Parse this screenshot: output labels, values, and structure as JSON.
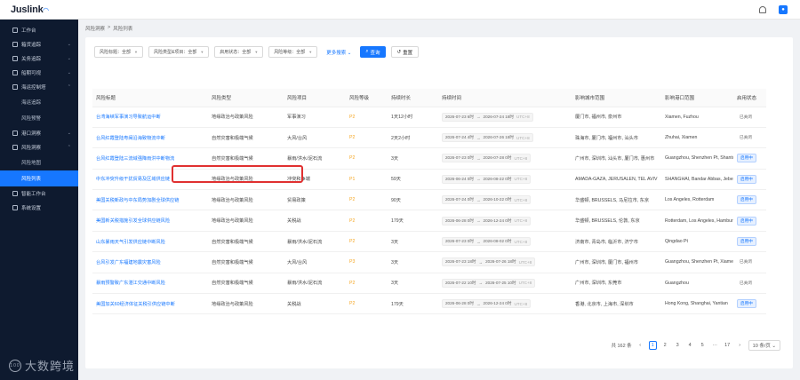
{
  "app": {
    "logo": "Juslink"
  },
  "sidebar": {
    "items": [
      {
        "label": "工作台",
        "icon": "home-icon"
      },
      {
        "label": "箱货追踪",
        "icon": "box-icon"
      },
      {
        "label": "关务追踪",
        "icon": "customs-icon"
      },
      {
        "label": "船期可视",
        "icon": "ship-icon"
      },
      {
        "label": "海运控制塔",
        "icon": "tower-icon"
      }
    ],
    "tower_sub": [
      {
        "label": "海运追踪"
      },
      {
        "label": "风险预警"
      }
    ],
    "items2": [
      {
        "label": "港口洞察",
        "icon": "port-icon"
      },
      {
        "label": "风险洞察",
        "icon": "risk-icon"
      }
    ],
    "risk_sub": [
      {
        "label": "风险地图"
      },
      {
        "label": "风险列表"
      }
    ],
    "items3": [
      {
        "label": "智能工作台",
        "icon": "smart-icon"
      },
      {
        "label": "系统设置",
        "icon": "settings-icon"
      }
    ],
    "watermark": "大数跨境"
  },
  "breadcrumb": {
    "parent": "风险洞察",
    "sep": ">",
    "current": "风险列表"
  },
  "filters": {
    "title": "风险标题：全部",
    "type": "风险类型&项目：全部",
    "status": "启用状态：全部",
    "level": "风险等级：全部",
    "more": "更多搜索",
    "query": "查询",
    "reset": "重置"
  },
  "table": {
    "headers": [
      "风险标题",
      "风险类型",
      "风险项目",
      "风险等级",
      "持续时长",
      "持续时间",
      "影响城市范围",
      "影响港口范围",
      "启用状态"
    ],
    "rows": [
      {
        "title": "台湾海峡军事演习导致航运中断",
        "type": "地缘政治与政策风险",
        "item": "军事演习",
        "level": "P2",
        "dur": "1天12小时",
        "start": "2026-07-23 6时",
        "end": "2026-07-24 18时",
        "utc": "UTC+8",
        "cities": "厦门市, 福州市, 泉州市",
        "ports": "Xiamen, Fuzhou",
        "status": "已关闭",
        "on": false
      },
      {
        "title": "台风红霞登陆粤闽沿海致物流中断",
        "type": "自然灾害和极端气候",
        "item": "大风/台风",
        "level": "P2",
        "dur": "2天2小时",
        "start": "2026-07-24 4时",
        "end": "2026-07-26 18时",
        "utc": "UTC+8",
        "cities": "珠海市, 厦门市, 福州市, 汕头市",
        "ports": "Zhuhai, Xiamen",
        "status": "已关闭",
        "on": false
      },
      {
        "title": "台风红霞登陆三流域强降雨洪中断物流",
        "type": "自然灾害和极端气候",
        "item": "暴雨/洪水/泥石流",
        "level": "P2",
        "dur": "3天",
        "start": "2026-07-23 0时",
        "end": "2026-07-28 0时",
        "utc": "UTC+8",
        "cities": "广州市, 深圳市, 汕头市, 厦门市, 惠州市",
        "ports": "Guangzhou, Shenzhen Pt, Shantou",
        "status": "启用中",
        "on": true
      },
      {
        "title": "中东冲突升级干扰贸易及区域供应链",
        "type": "地缘政治与政策风险",
        "item": "冲突和争端",
        "level": "P1",
        "dur": "59天",
        "start": "2026-06-24 0时",
        "end": "2026-08-22 0时",
        "utc": "UTC+8",
        "cities": "AMADA-GAZA, JERUSALEN, TEL AVIV",
        "ports": "SHANGHAI, Bandar Abbas, Jebel Ali",
        "status": "启用中",
        "on": true
      },
      {
        "title": "美国关税新政与中东局势加剧全球供应链",
        "type": "地缘政治与政策风险",
        "item": "贸易政策",
        "level": "P2",
        "dur": "90天",
        "start": "2026-07-24 0时",
        "end": "2026-10-22 0时",
        "utc": "UTC+8",
        "cities": "华盛顿, BRUSSELS, 马尼拉市, 东京",
        "ports": "Los Angeles, Rotterdam",
        "status": "启用中",
        "on": true
      },
      {
        "title": "美国新关税措施引发全球供应链风险",
        "type": "地缘政治与政策风险",
        "item": "关税战",
        "level": "P2",
        "dur": "179天",
        "start": "2026-06-28 0时",
        "end": "2026-12-24 0时",
        "utc": "UTC+8",
        "cities": "华盛顿, BRUSSELS, 伦敦, 东京",
        "ports": "Rotterdam, Los Angeles, Hamburg",
        "status": "启用中",
        "on": true
      },
      {
        "title": "山东暴雨天气引发供应链中断风险",
        "type": "自然灾害和极端气候",
        "item": "暴雨/洪水/泥石流",
        "level": "P2",
        "dur": "3天",
        "start": "2026-07-23 0时",
        "end": "2026-08-02 0时",
        "utc": "UTC+8",
        "cities": "济南市, 青岛市, 临沂市, 济宁市",
        "ports": "Qingdao Pt",
        "status": "启用中",
        "on": true
      },
      {
        "title": "台风引发广东福建地震灾害风险",
        "type": "自然灾害和极端气候",
        "item": "大风/台风",
        "level": "P3",
        "dur": "3天",
        "start": "2026-07-23 18时",
        "end": "2026-07-26 18时",
        "utc": "UTC+8",
        "cities": "广州市, 深圳市, 厦门市, 福州市",
        "ports": "Guangzhou, Shenzhen Pt, Xiamen",
        "status": "已关闭",
        "on": false
      },
      {
        "title": "暴雨预警致广东湛江交通中断风险",
        "type": "自然灾害和极端气候",
        "item": "暴雨/洪水/泥石流",
        "level": "P2",
        "dur": "3天",
        "start": "2026-07-22 10时",
        "end": "2026-07-25 10时",
        "utc": "UTC+8",
        "cities": "广州市, 深圳市, 东莞市",
        "ports": "Guangzhou",
        "status": "已关闭",
        "on": false
      },
      {
        "title": "美国加关60经济体征关税引供应链中断",
        "type": "地缘政治与政策风险",
        "item": "关税战",
        "level": "P2",
        "dur": "179天",
        "start": "2026-06-28 0时",
        "end": "2026-12-24 0时",
        "utc": "UTC+8",
        "cities": "香港, 北京市, 上海市, 深圳市",
        "ports": "Hong Kong, Shanghai, Yantian",
        "status": "启用中",
        "on": true
      }
    ],
    "time_sep": "→"
  },
  "pagination": {
    "total": "共 162 条",
    "prev": "‹",
    "pages": [
      "1",
      "2",
      "3",
      "4",
      "5"
    ],
    "ellipsis": "···",
    "last": "17",
    "next": "›",
    "size": "10 条/页"
  }
}
